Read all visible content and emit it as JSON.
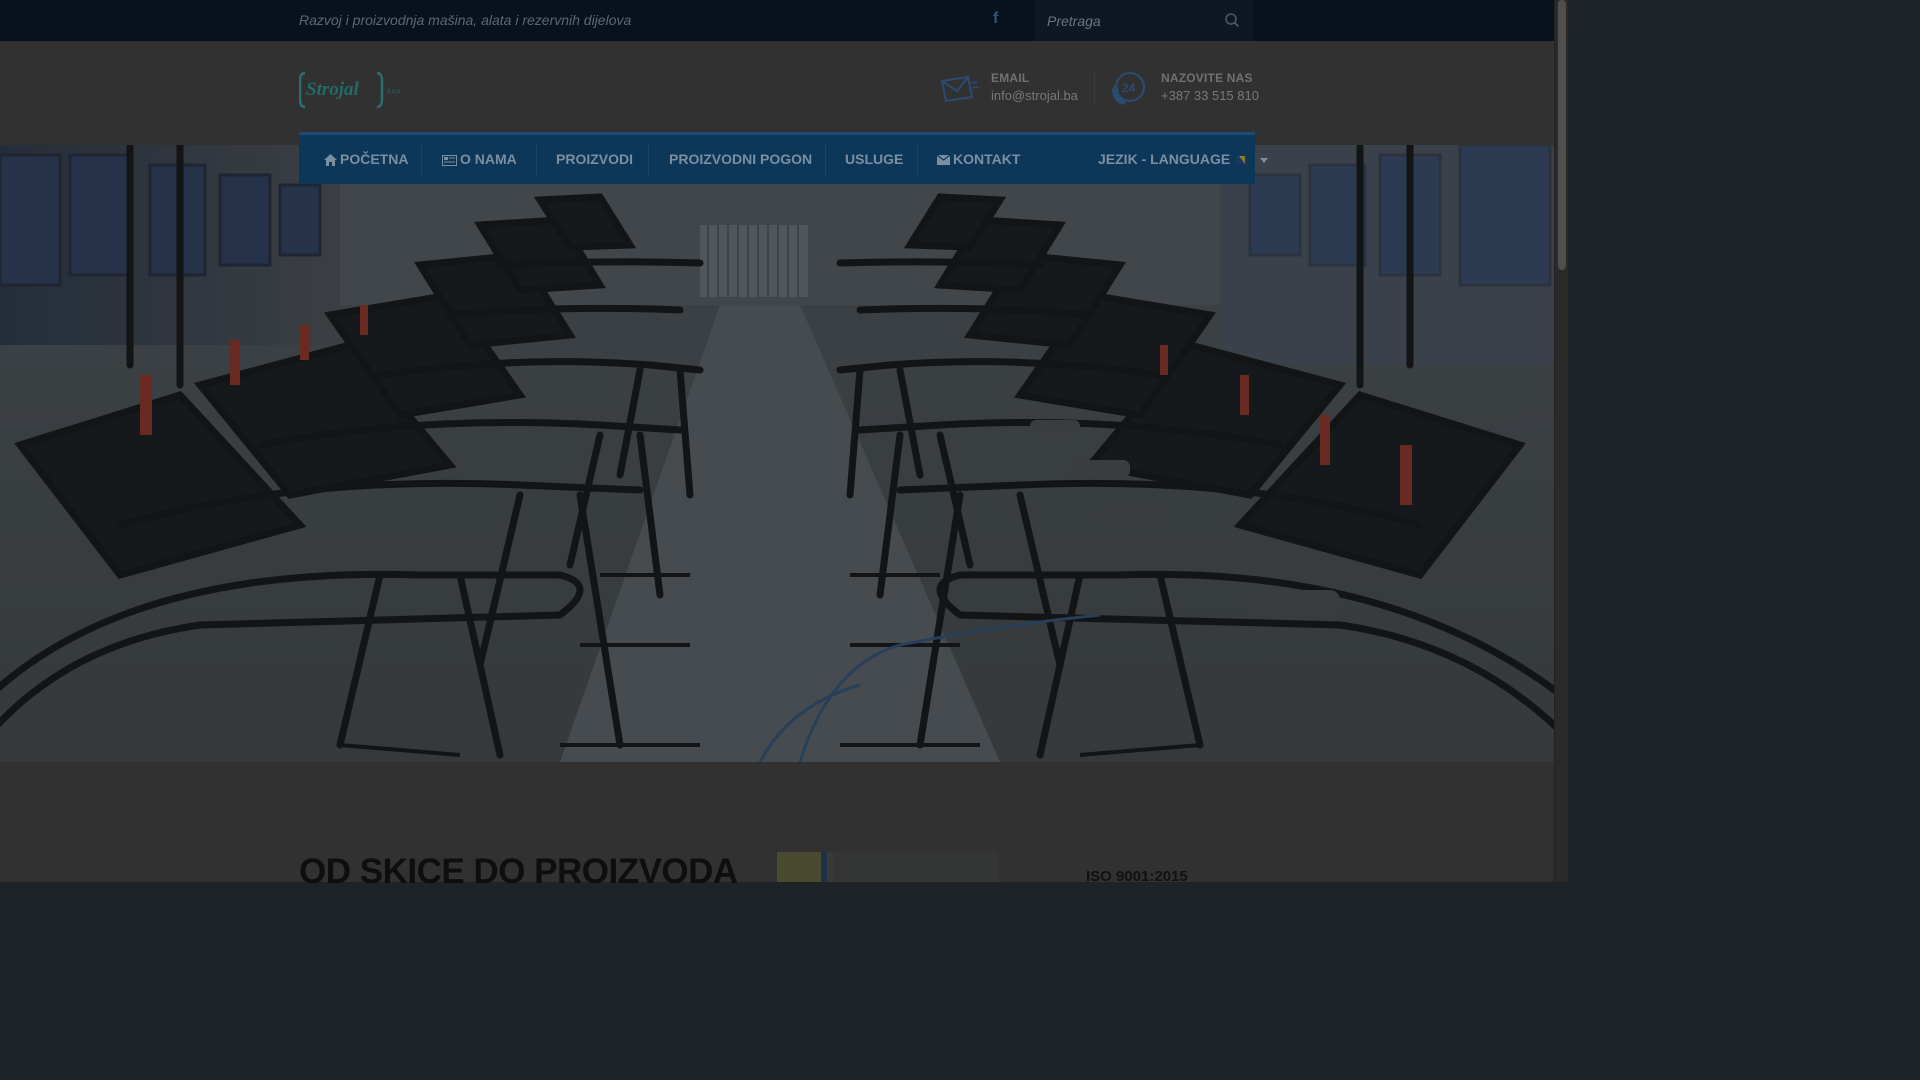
{
  "topbar": {
    "tagline": "Razvoj i proizvodnja mašina, alata i rezervnih dijelova",
    "facebook_icon": "facebook-icon",
    "search_placeholder": "Pretraga",
    "search_icon": "search-icon"
  },
  "header": {
    "logo_text": "Strojal",
    "logo_suffix": "d.o.o.",
    "email": {
      "label": "EMAIL",
      "value": "info@strojal.ba",
      "icon": "mail-icon"
    },
    "phone": {
      "label": "NAZOVITE NAS",
      "value": "+387 33 515 810",
      "icon": "phone-24-icon"
    }
  },
  "nav": {
    "items": [
      {
        "label": "POČETNA",
        "icon": "home-icon"
      },
      {
        "label": "O NAMA",
        "icon": "newspaper-icon"
      },
      {
        "label": "PROIZVODI",
        "icon": ""
      },
      {
        "label": "PROIZVODNI POGON",
        "icon": ""
      },
      {
        "label": "USLUGE",
        "icon": ""
      },
      {
        "label": "KONTAKT",
        "icon": "envelope-icon"
      },
      {
        "label": "JEZIK - LANGUAGE",
        "icon": "flag-icon"
      }
    ]
  },
  "content": {
    "heading": "OD SKICE DO PROIZVODA",
    "certificate": "ISO 9001:2015"
  },
  "colors": {
    "topbar_bg": "#08121c",
    "nav_bg": "#0c3758",
    "header_bg": "#313131"
  }
}
